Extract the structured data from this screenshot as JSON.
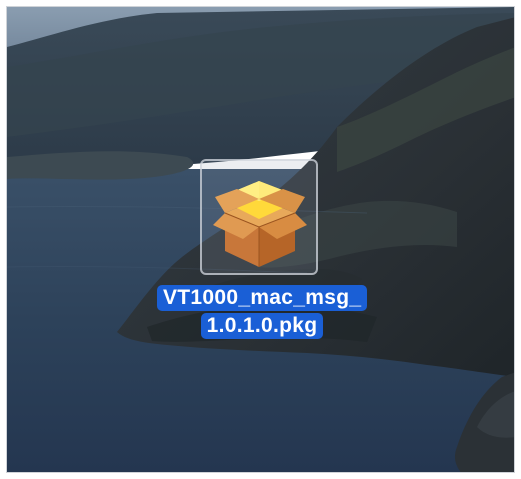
{
  "desktop": {
    "wallpaper": "coastal-cliffs-evening",
    "colors": {
      "sky": "#7f93a6",
      "sea": "#2b3e55",
      "cliff": "#2a3136",
      "selection_label": "#1a5fd6",
      "selection_border": "#d2d6dc"
    }
  },
  "file": {
    "icon": "installer-package-icon",
    "name_line1": "VT1000_mac_msg_",
    "name_line2": "1.0.1.0.pkg",
    "selected": true
  }
}
